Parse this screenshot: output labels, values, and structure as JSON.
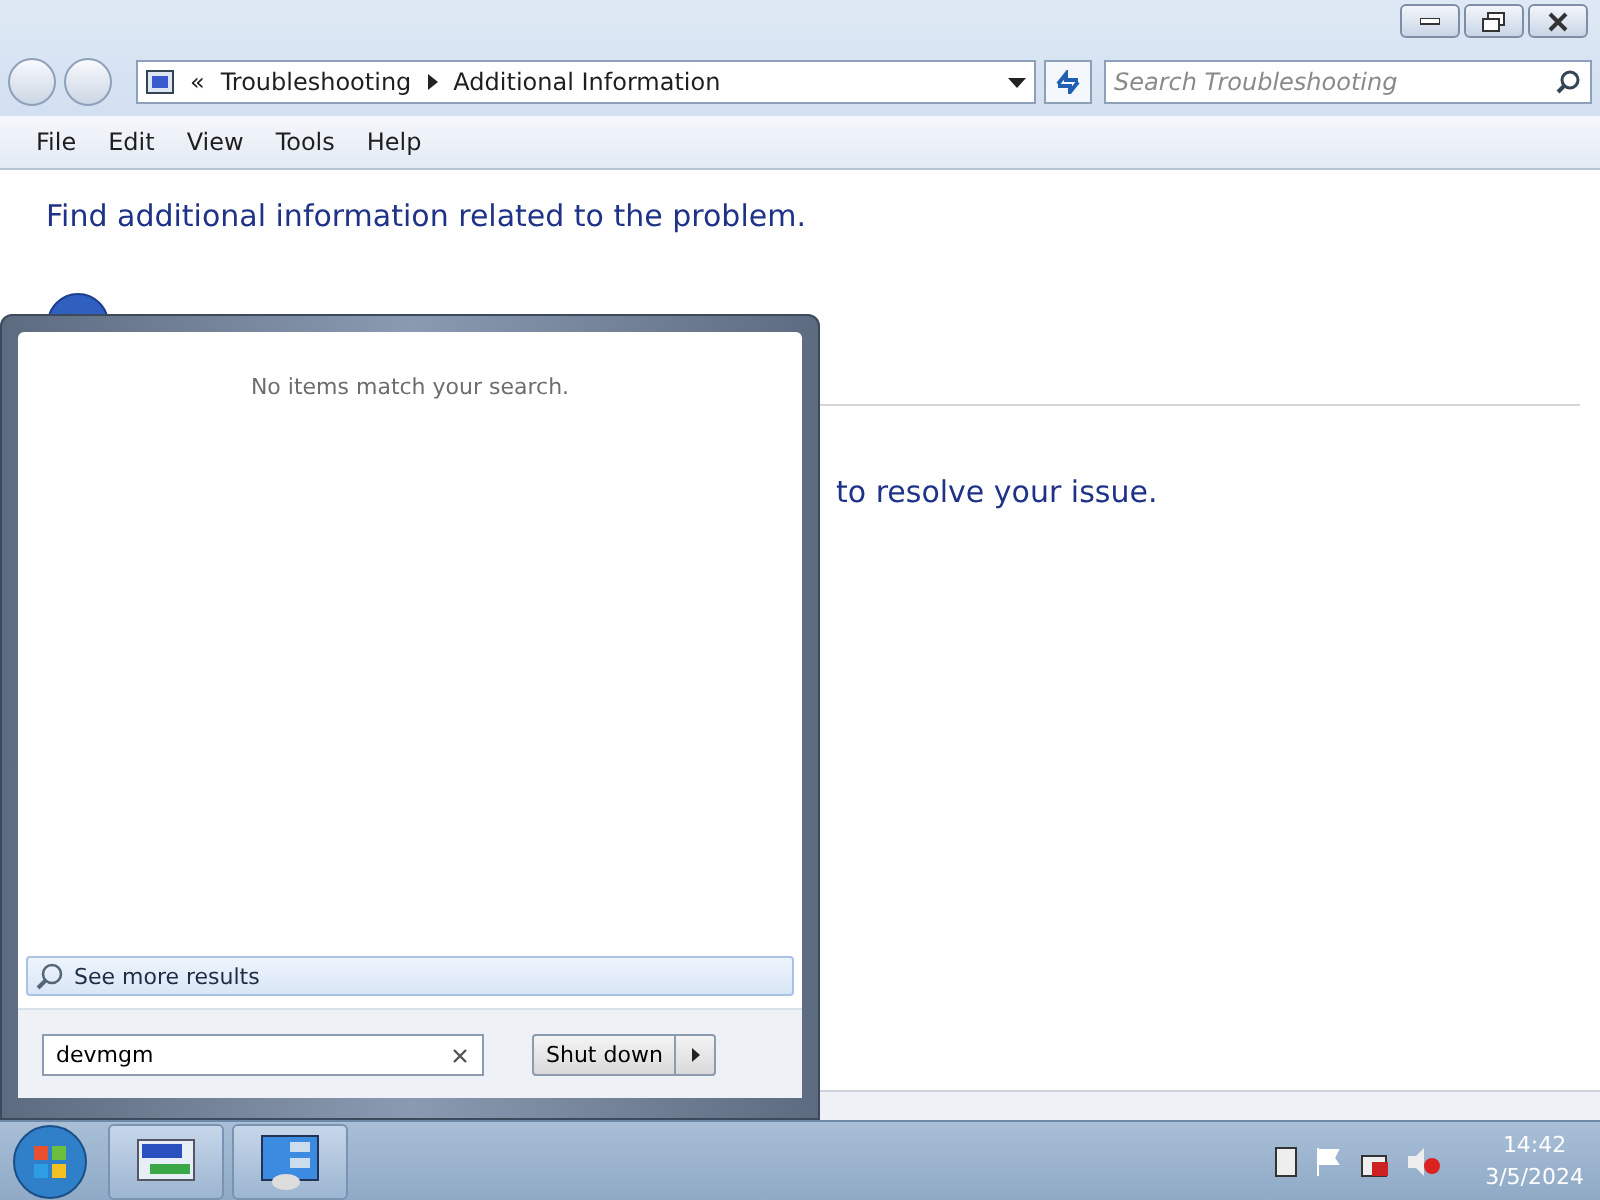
{
  "window": {
    "breadcrumb": [
      "«",
      "Troubleshooting",
      "Additional Information"
    ],
    "search": {
      "placeholder": "Search Troubleshooting"
    },
    "menu": [
      "File",
      "Edit",
      "View",
      "Tools",
      "Help"
    ]
  },
  "content": {
    "heading": "Find additional information related to the problem.",
    "partial_text": "to resolve your issue."
  },
  "start_menu": {
    "message": "No items match your search.",
    "see_more": "See more results",
    "search_value": "devmgm",
    "shutdown": "Shut down"
  },
  "tray": {
    "time": "14:42",
    "date": "3/5/2024"
  }
}
